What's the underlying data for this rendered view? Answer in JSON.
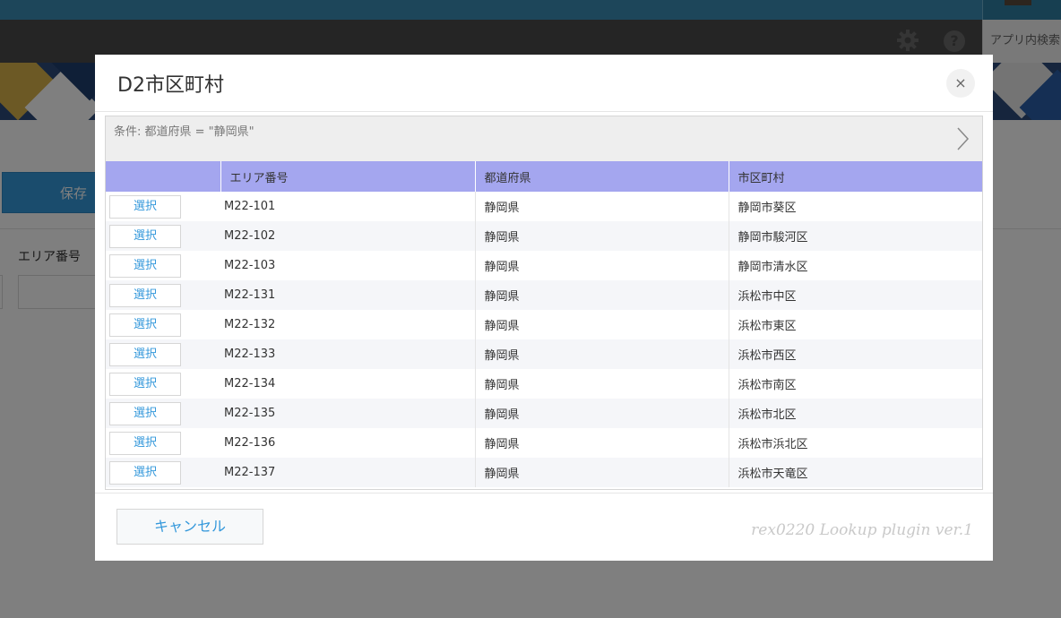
{
  "app": {
    "search_label": "アプリ内検索",
    "save_label": "保存",
    "field_label": "エリア番号"
  },
  "modal": {
    "title": "D2市区町村",
    "close_label": "×",
    "condition": "条件: 都道府県 = \"静岡県\"",
    "columns": [
      "",
      "エリア番号",
      "都道府県",
      "市区町村"
    ],
    "select_label": "選択",
    "rows": [
      {
        "area": "M22-101",
        "pref": "静岡県",
        "city": "静岡市葵区"
      },
      {
        "area": "M22-102",
        "pref": "静岡県",
        "city": "静岡市駿河区"
      },
      {
        "area": "M22-103",
        "pref": "静岡県",
        "city": "静岡市清水区"
      },
      {
        "area": "M22-131",
        "pref": "静岡県",
        "city": "浜松市中区"
      },
      {
        "area": "M22-132",
        "pref": "静岡県",
        "city": "浜松市東区"
      },
      {
        "area": "M22-133",
        "pref": "静岡県",
        "city": "浜松市西区"
      },
      {
        "area": "M22-134",
        "pref": "静岡県",
        "city": "浜松市南区"
      },
      {
        "area": "M22-135",
        "pref": "静岡県",
        "city": "浜松市北区"
      },
      {
        "area": "M22-136",
        "pref": "静岡県",
        "city": "浜松市浜北区"
      },
      {
        "area": "M22-137",
        "pref": "静岡県",
        "city": "浜松市天竜区"
      }
    ],
    "cancel_label": "キャンセル",
    "credit": "rex0220 Lookup plugin ver.1"
  },
  "colors": {
    "header_bar": "#3a8db4",
    "nav_bar": "#4a4a4a",
    "table_header": "#a4a6ef",
    "link_blue": "#3498db"
  }
}
